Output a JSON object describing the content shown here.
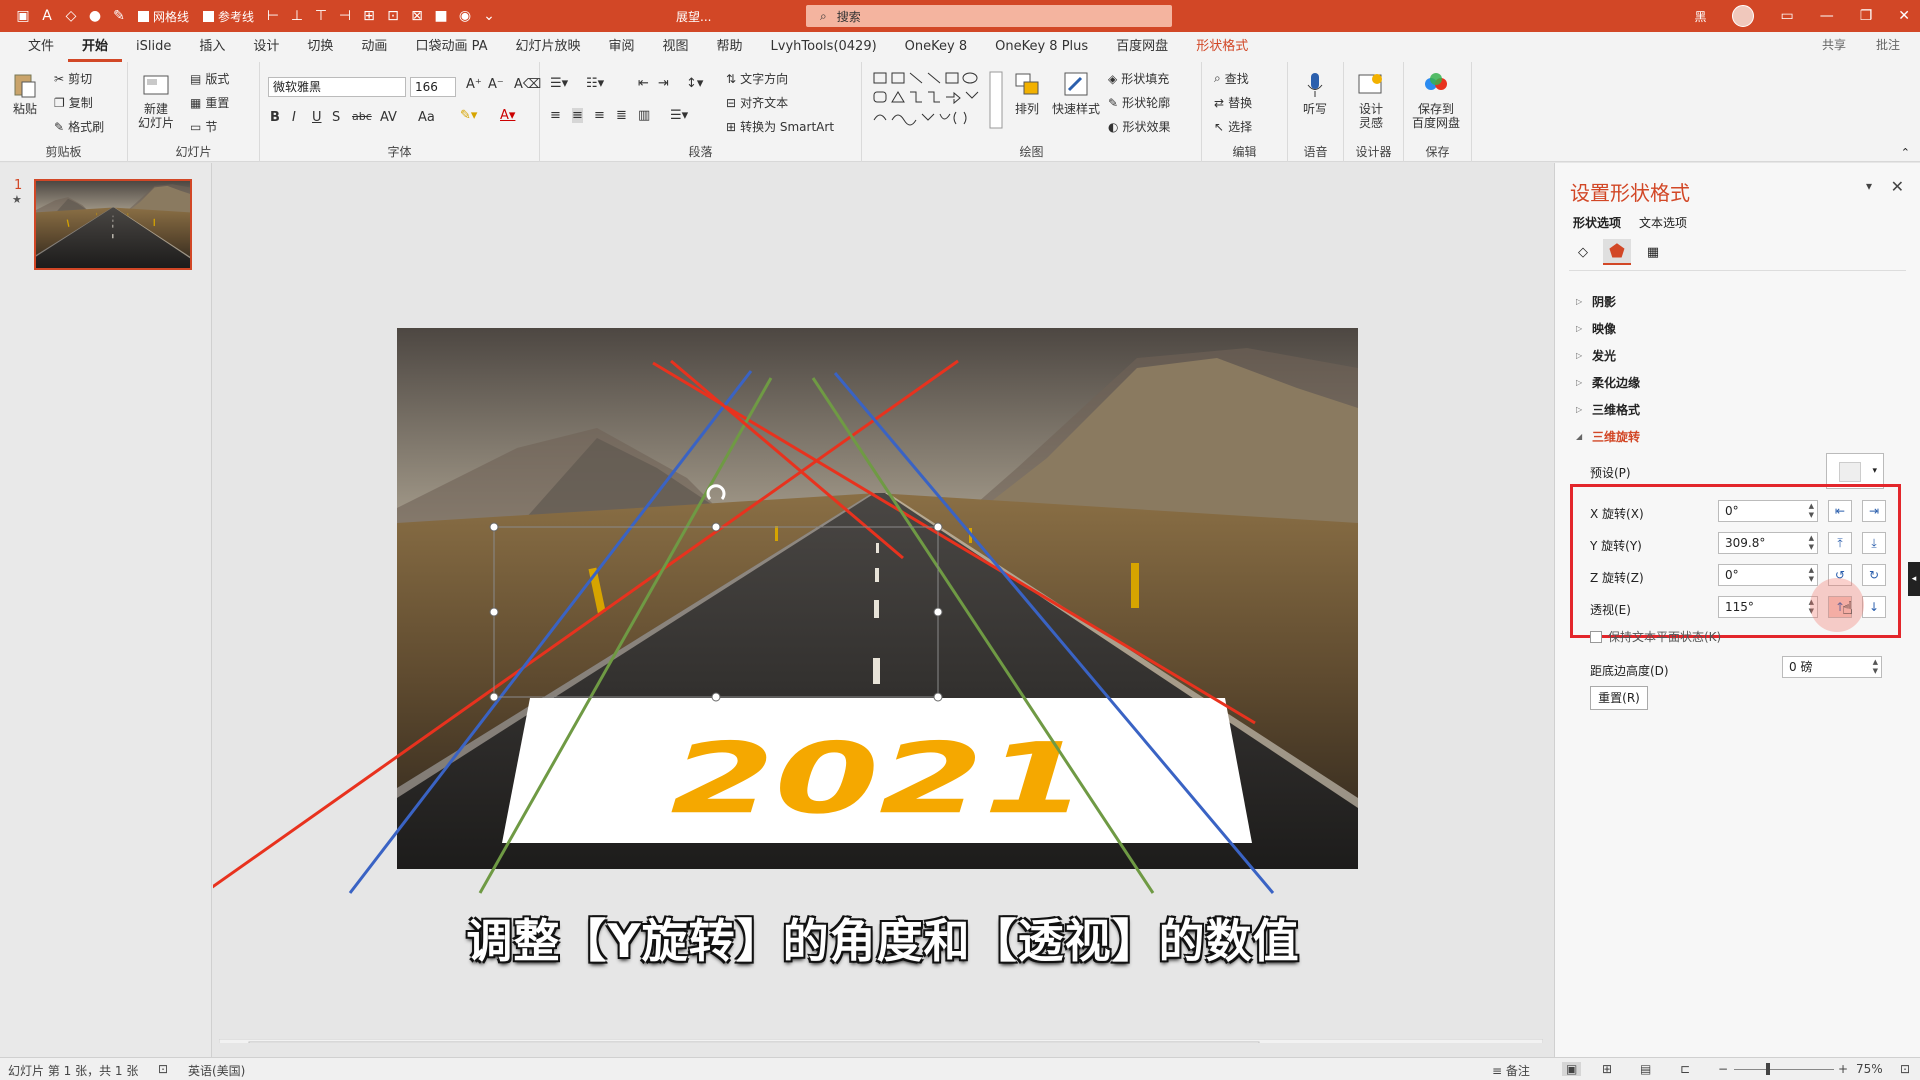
{
  "titlebar": {
    "checkboxes": [
      "网格线",
      "参考线"
    ],
    "doc_title": "展望...",
    "search_placeholder": "搜索",
    "user": "黑",
    "window_buttons": [
      "—",
      "❐",
      "✕"
    ]
  },
  "tabs": [
    "文件",
    "开始",
    "iSlide",
    "插入",
    "设计",
    "切换",
    "动画",
    "口袋动画 PA",
    "幻灯片放映",
    "审阅",
    "视图",
    "帮助",
    "LvyhTools(0429)",
    "OneKey 8",
    "OneKey 8 Plus",
    "百度网盘",
    "形状格式"
  ],
  "active_tab": "开始",
  "share": {
    "share_label": "共享",
    "comment_label": "批注"
  },
  "ribbon": {
    "clipboard": {
      "paste": "粘贴",
      "cut": "剪切",
      "copy": "复制",
      "painter": "格式刷",
      "label": "剪贴板"
    },
    "slides": {
      "new_slide": "新建\n幻灯片",
      "layout": "版式",
      "reset": "重置",
      "section": "节",
      "label": "幻灯片"
    },
    "font": {
      "font_name": "微软雅黑",
      "font_size": "166",
      "label": "字体",
      "format_buttons": [
        "B",
        "I",
        "U",
        "S",
        "abc",
        "AV",
        "Aa"
      ]
    },
    "paragraph": {
      "text_direction": "文字方向",
      "align_text": "对齐文本",
      "smartart": "转换为 SmartArt",
      "label": "段落"
    },
    "drawing": {
      "arrange": "排列",
      "quick_styles": "快速样式",
      "shape_fill": "形状填充",
      "shape_outline": "形状轮廓",
      "shape_effects": "形状效果",
      "label": "绘图"
    },
    "editing": {
      "find": "查找",
      "replace": "替换",
      "select": "选择",
      "label": "编辑"
    },
    "voice": {
      "dictate": "听写",
      "label": "语音"
    },
    "designer": {
      "design_ideas": "设计\n灵感",
      "label": "设计器"
    },
    "save": {
      "save_to_baidu": "保存到\n百度网盘",
      "label": "保存"
    }
  },
  "thumbnails": {
    "slide_number": "1",
    "star": "★"
  },
  "slide": {
    "text_2021": "2021",
    "caption": "调整【Y旋转】的角度和【透视】的数值"
  },
  "format_pane": {
    "title": "设置形状格式",
    "subtabs": [
      "形状选项",
      "文本选项"
    ],
    "sections": [
      "阴影",
      "映像",
      "发光",
      "柔化边缘",
      "三维格式",
      "三维旋转"
    ],
    "open_section": "三维旋转",
    "preset_label": "预设(P)",
    "fields": [
      {
        "label": "X 旋转(X)",
        "value": "0°"
      },
      {
        "label": "Y 旋转(Y)",
        "value": "309.8°"
      },
      {
        "label": "Z 旋转(Z)",
        "value": "0°"
      },
      {
        "label": "透视(E)",
        "value": "115°"
      }
    ],
    "keep_text_flat": "保持文本平面状态(K)",
    "distance_label": "距底边高度(D)",
    "distance_value": "0 磅",
    "reset_label": "重置(R)",
    "highlight_color": "#e3262b"
  },
  "statusbar": {
    "slide_info": "幻灯片 第 1 张，共 1 张",
    "language": "英语(美国)",
    "notes": "备注",
    "zoom": "75%"
  },
  "colors": {
    "accent": "#d24726",
    "text_2021": "#f5a800",
    "red_line": "#e8321e",
    "blue_line": "#3a63c4",
    "green_line": "#6f9a44"
  }
}
